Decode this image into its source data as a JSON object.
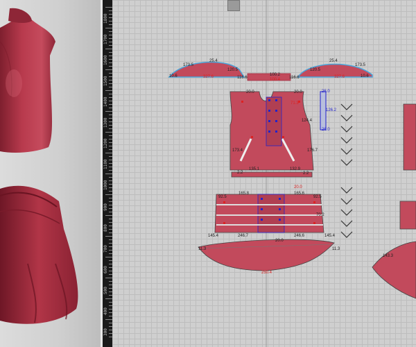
{
  "ruler": {
    "labels": [
      "1800",
      "1700",
      "1600",
      "1500",
      "1400",
      "1300",
      "1200",
      "1100",
      "1000",
      "900",
      "800",
      "700",
      "600",
      "500",
      "400",
      "300"
    ]
  },
  "colors": {
    "fabric": "#c24a5c",
    "fabric_dark": "#9e2e40",
    "grid": "#bdbdbd",
    "seam_blue": "#4aa3d8",
    "measure_red": "#d22",
    "measure_blue": "#2222cc"
  },
  "icons": {
    "tool": "layers-icon",
    "seams": "stitch-point-icon"
  },
  "measurements": {
    "sleeve_left": [
      "25.4",
      "173.5",
      "120.5",
      "10.6",
      "116.6",
      "327.6"
    ],
    "sleeve_right": [
      "25.4",
      "173.5",
      "120.5",
      "10.6",
      "116.6",
      "327.6"
    ],
    "cuff": [
      "100.2",
      "100.4"
    ],
    "bodice": [
      "20.0",
      "20.0",
      "124.4",
      "176.7",
      "173.4",
      "135.1",
      "132.9",
      "2.2",
      "2.2",
      "71.3"
    ],
    "waistband": [
      "165.8",
      "165.6",
      "92.5",
      "92.5",
      "70.2",
      "20.0",
      "20.0"
    ],
    "skirt": [
      "246.7",
      "246.6",
      "145.4",
      "145.4",
      "250.4",
      "11.3",
      "11.3",
      "143.3"
    ],
    "strap": [
      "26.0",
      "26.0",
      "126.2"
    ]
  }
}
